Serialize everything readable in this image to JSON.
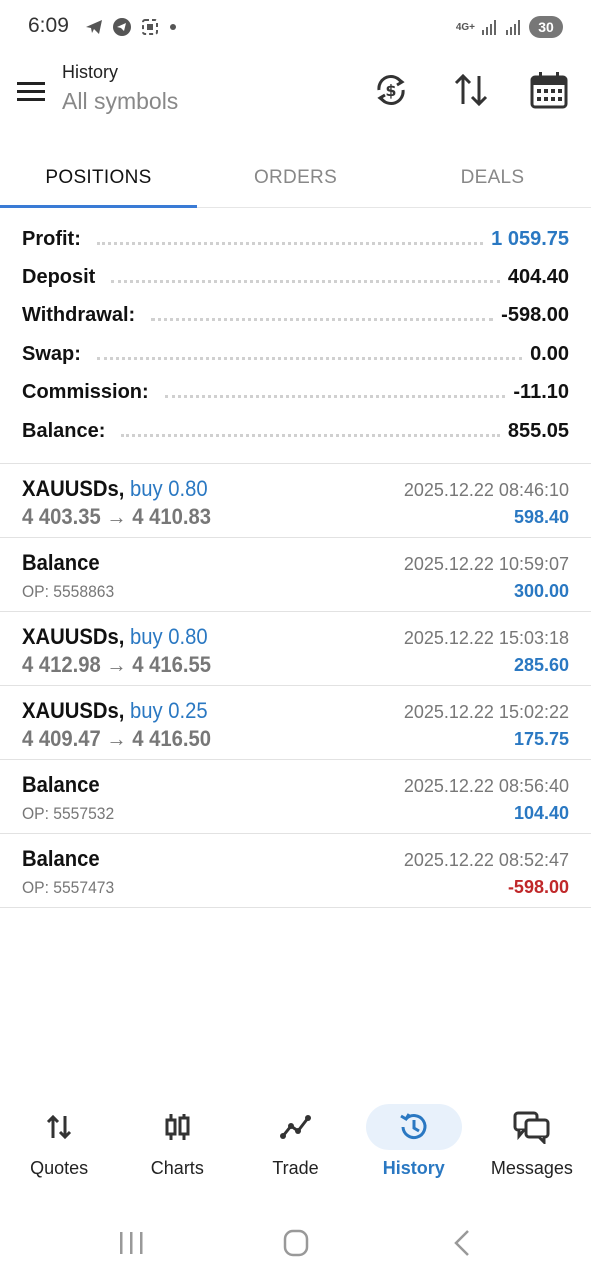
{
  "status_bar": {
    "time": "6:09",
    "network": "4G+",
    "battery": "30"
  },
  "app_bar": {
    "title": "History",
    "subtitle": "All symbols",
    "icons": [
      "menu-icon",
      "currency-exchange-icon",
      "sort-icon",
      "calendar-icon"
    ]
  },
  "tabs": [
    {
      "label": "POSITIONS",
      "active": true
    },
    {
      "label": "ORDERS",
      "active": false
    },
    {
      "label": "DEALS",
      "active": false
    }
  ],
  "summary": [
    {
      "label": "Profit:",
      "value": "1 059.75",
      "accent": true
    },
    {
      "label": "Deposit",
      "value": "404.40",
      "accent": false
    },
    {
      "label": "Withdrawal:",
      "value": "-598.00",
      "accent": false
    },
    {
      "label": "Swap:",
      "value": "0.00",
      "accent": false
    },
    {
      "label": "Commission:",
      "value": "-11.10",
      "accent": false
    },
    {
      "label": "Balance:",
      "value": "855.05",
      "accent": false
    }
  ],
  "records": [
    {
      "symbol": "XAUUSDs,",
      "side": "buy 0.80",
      "detail": "4 403.35 → 4 410.83",
      "time": "2025.12.22 08:46:10",
      "amount": "598.40",
      "negative": false,
      "kind": "trade"
    },
    {
      "symbol": "Balance",
      "side": "",
      "detail": "OP: 5558863",
      "time": "2025.12.22 10:59:07",
      "amount": "300.00",
      "negative": false,
      "kind": "balance"
    },
    {
      "symbol": "XAUUSDs,",
      "side": "buy 0.80",
      "detail": "4 412.98 → 4 416.55",
      "time": "2025.12.22 15:03:18",
      "amount": "285.60",
      "negative": false,
      "kind": "trade"
    },
    {
      "symbol": "XAUUSDs,",
      "side": "buy 0.25",
      "detail": "4 409.47 → 4 416.50",
      "time": "2025.12.22 15:02:22",
      "amount": "175.75",
      "negative": false,
      "kind": "trade"
    },
    {
      "symbol": "Balance",
      "side": "",
      "detail": "OP: 5557532",
      "time": "2025.12.22 08:56:40",
      "amount": "104.40",
      "negative": false,
      "kind": "balance"
    },
    {
      "symbol": "Balance",
      "side": "",
      "detail": "OP: 5557473",
      "time": "2025.12.22 08:52:47",
      "amount": "-598.00",
      "negative": true,
      "kind": "balance"
    }
  ],
  "bottom_nav": [
    {
      "label": "Quotes",
      "icon": "quotes-arrows-icon",
      "active": false
    },
    {
      "label": "Charts",
      "icon": "candlestick-icon",
      "active": false
    },
    {
      "label": "Trade",
      "icon": "trade-line-icon",
      "active": false
    },
    {
      "label": "History",
      "icon": "history-clock-icon",
      "active": true
    },
    {
      "label": "Messages",
      "icon": "messages-icon",
      "active": false
    }
  ],
  "colors": {
    "accent": "#2a78c2",
    "negative": "#c0282a",
    "tab_indicator": "#3a7bd5"
  }
}
